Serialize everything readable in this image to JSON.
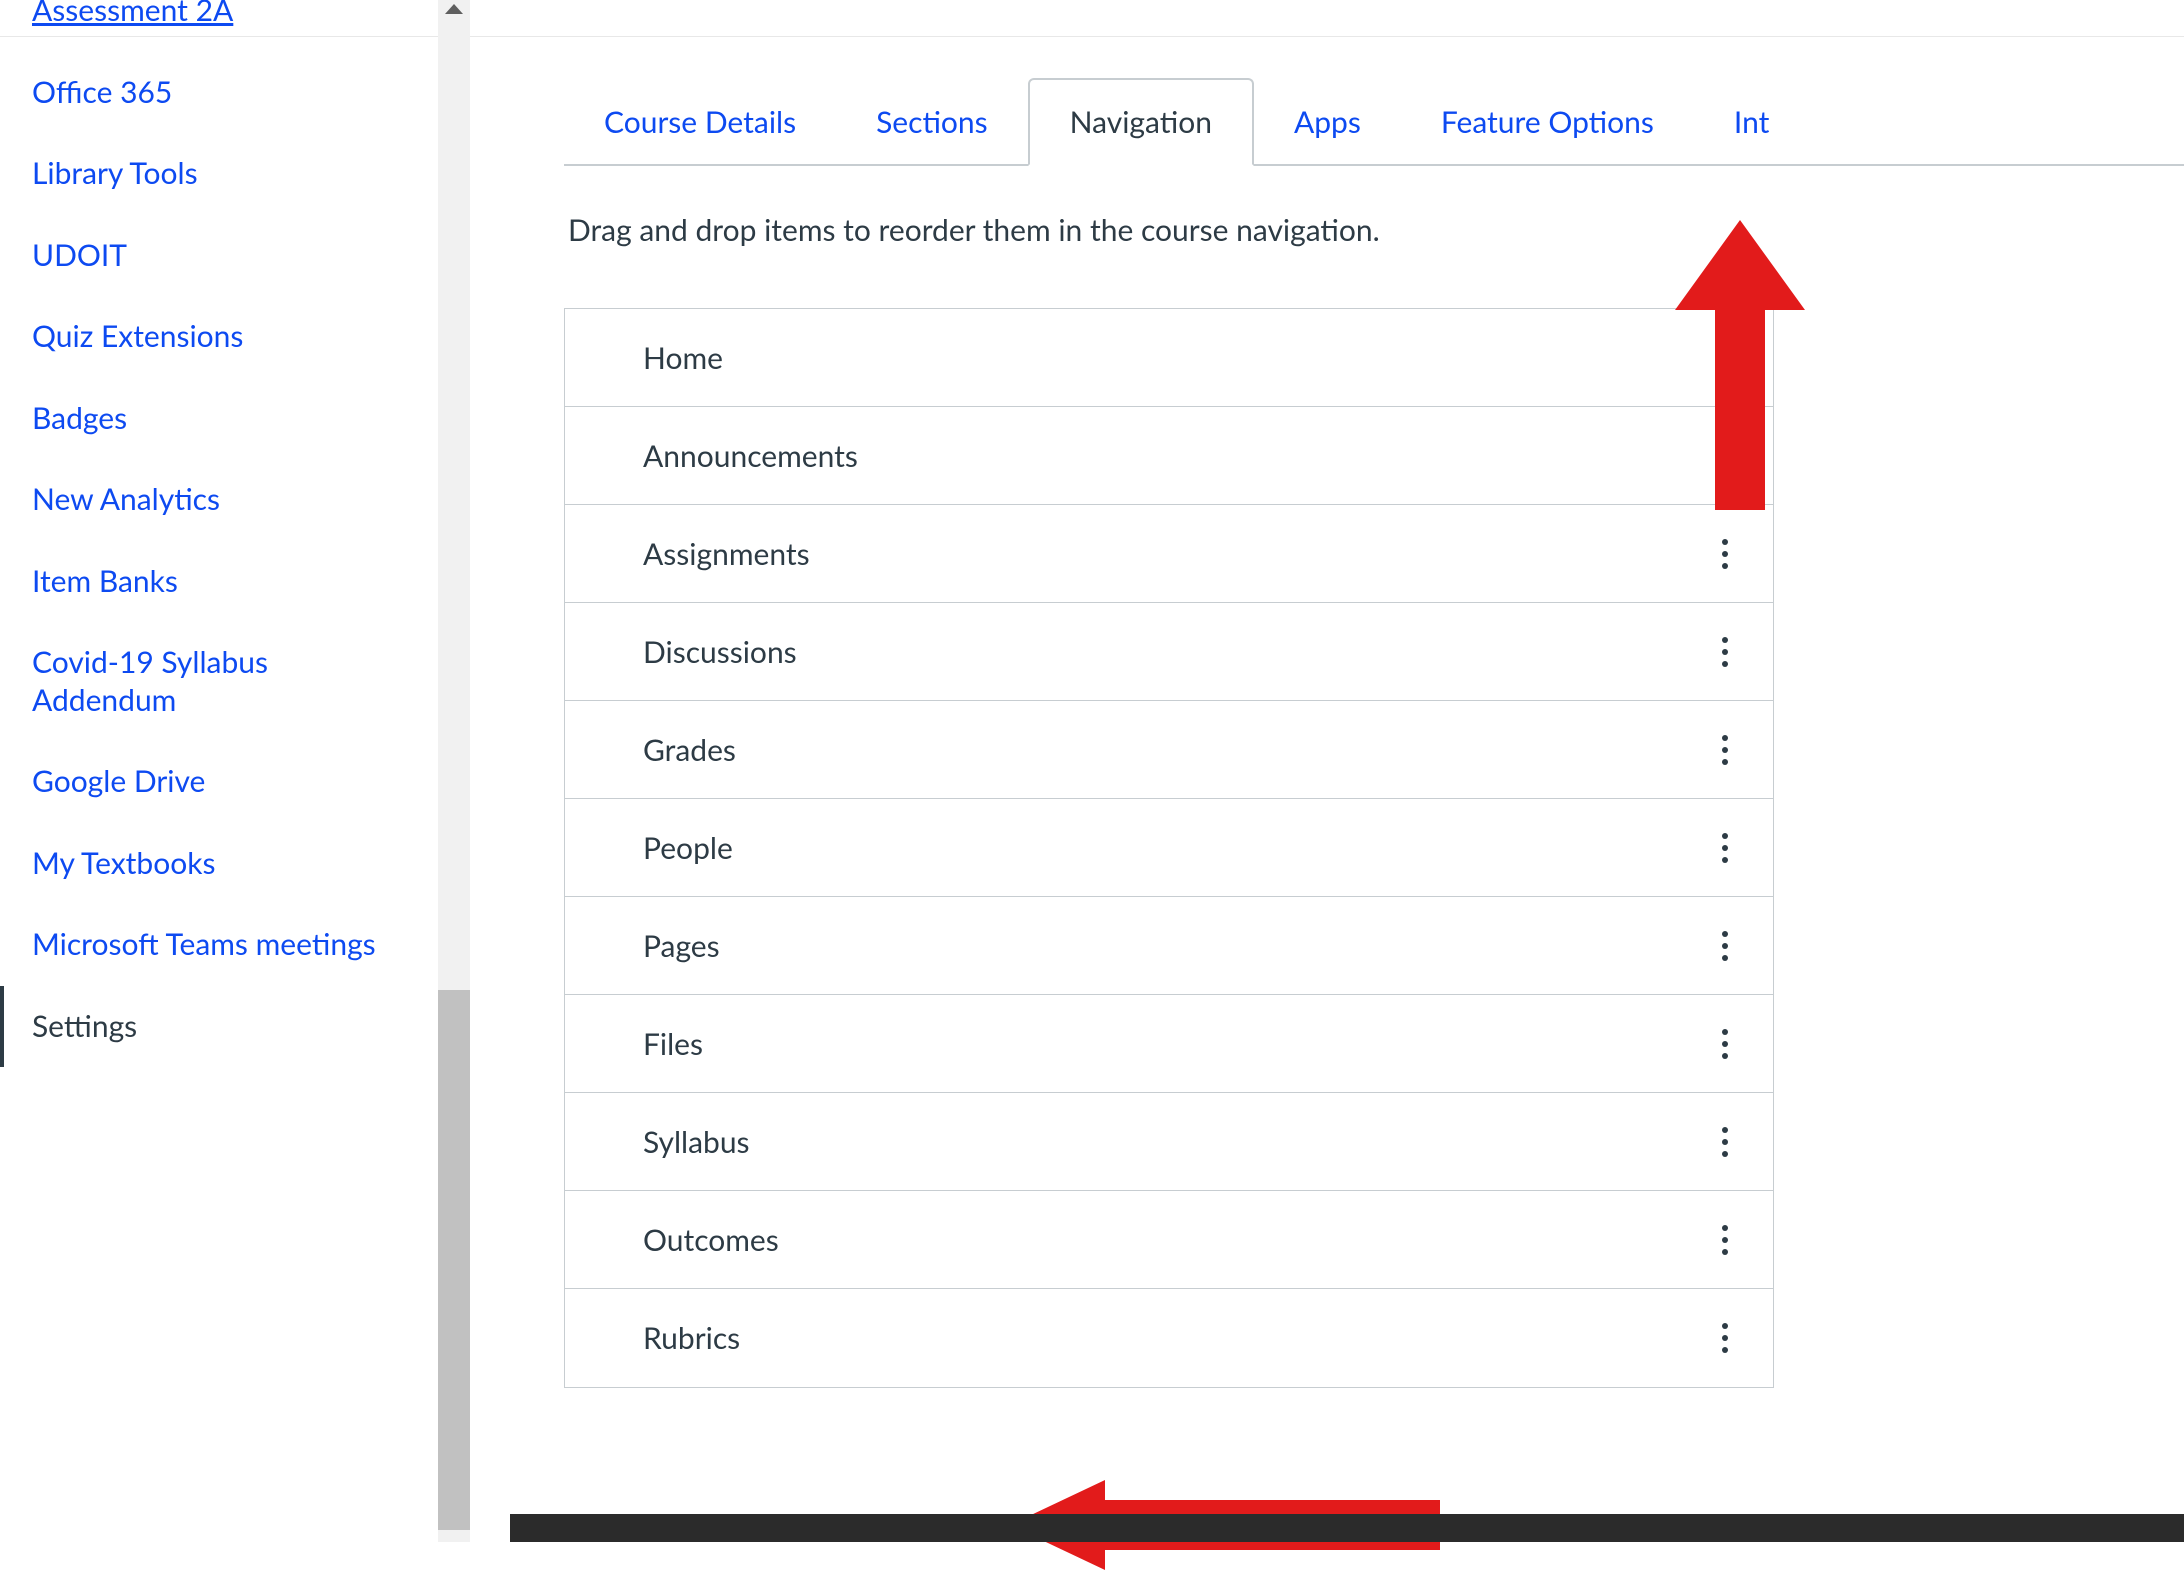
{
  "sidebar": {
    "truncated_item": "Assessment 2A",
    "items": [
      "Office 365",
      "Library Tools",
      "UDOIT",
      "Quiz Extensions",
      "Badges",
      "New Analytics",
      "Item Banks",
      "Covid-19 Syllabus Addendum",
      "Google Drive",
      "My Textbooks",
      "Microsoft Teams meetings"
    ],
    "active_item": "Settings"
  },
  "tabs": {
    "items": [
      "Course Details",
      "Sections",
      "Navigation",
      "Apps",
      "Feature Options",
      "Int"
    ],
    "active_index": 2
  },
  "instructions": "Drag and drop items to reorder them in the course navigation.",
  "nav_items": [
    {
      "label": "Home",
      "has_menu": false
    },
    {
      "label": "Announcements",
      "has_menu": true
    },
    {
      "label": "Assignments",
      "has_menu": true
    },
    {
      "label": "Discussions",
      "has_menu": true
    },
    {
      "label": "Grades",
      "has_menu": true
    },
    {
      "label": "People",
      "has_menu": true
    },
    {
      "label": "Pages",
      "has_menu": true
    },
    {
      "label": "Files",
      "has_menu": true
    },
    {
      "label": "Syllabus",
      "has_menu": true
    },
    {
      "label": "Outcomes",
      "has_menu": true
    },
    {
      "label": "Rubrics",
      "has_menu": true
    }
  ],
  "annotation_color": "#e21b1b"
}
